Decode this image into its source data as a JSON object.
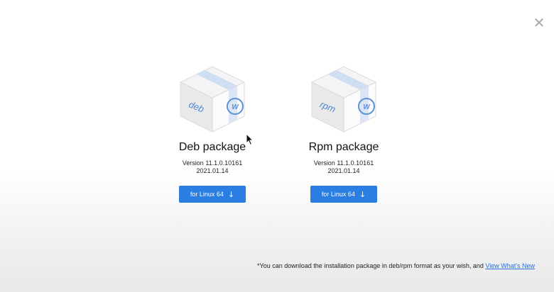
{
  "close_icon": "close-icon",
  "packages": [
    {
      "box_label": "deb",
      "title": "Deb package",
      "version": "Version 11.1.0.10161",
      "date": "2021.01.14",
      "button_label": "for Linux 64"
    },
    {
      "box_label": "rpm",
      "title": "Rpm package",
      "version": "Version 11.1.0.10161",
      "date": "2021.01.14",
      "button_label": "for Linux 64"
    }
  ],
  "footnote": {
    "text": "*You can download the installation package in deb/rpm format as your wish, and ",
    "link": "View What's New"
  },
  "colors": {
    "accent": "#2a7de1",
    "link": "#2a6fd6"
  }
}
